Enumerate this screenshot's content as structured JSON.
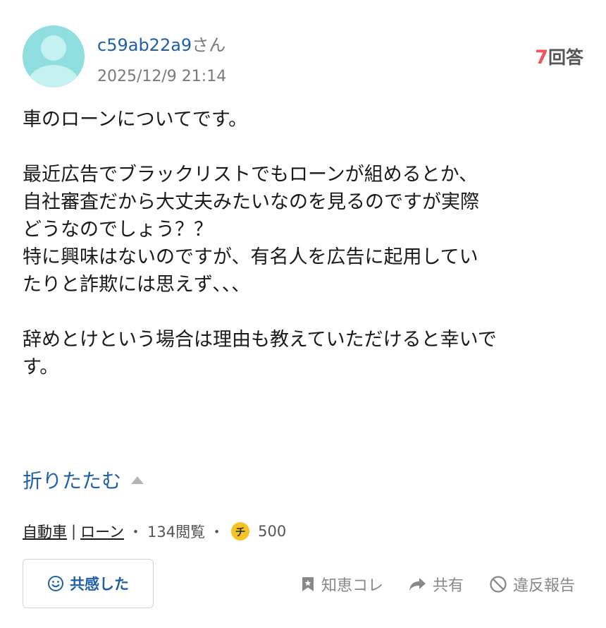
{
  "header": {
    "username": "c59ab22a9",
    "suffix": "さん",
    "date": "2025/12/9 21:14",
    "answers_count": "7",
    "answers_label": "回答"
  },
  "question": {
    "body": "車のローンについてです。\n\n最近広告でブラックリストでもローンが組めるとか、\n自社審査だから大丈夫みたいなのを見るのですが実際\nどうなのでしょう？？\n特に興味はないのですが、有名人を広告に起用してい\nたりと詐欺には思えず､､､\n\n辞めとけという場合は理由も教えていただけると幸いで\nす。"
  },
  "collapse_label": "折りたたむ",
  "meta": {
    "category_1": "自動車",
    "separator": "|",
    "category_2": "ローン",
    "views": "134閲覧",
    "coin_glyph": "チ",
    "coins": "500"
  },
  "actions": {
    "empathy_label": "共感した",
    "save_label": "知恵コレ",
    "share_label": "共有",
    "report_label": "違反報告"
  },
  "colors": {
    "link": "#1f5fa8",
    "answer_count": "#f2545b",
    "avatar": "#8fdfe0",
    "coin": "#f6c324"
  },
  "icons": [
    "user-avatar-icon",
    "caret-up-icon",
    "coin-icon",
    "smile-icon",
    "bookmark-icon",
    "share-arrow-icon",
    "prohibited-icon"
  ]
}
